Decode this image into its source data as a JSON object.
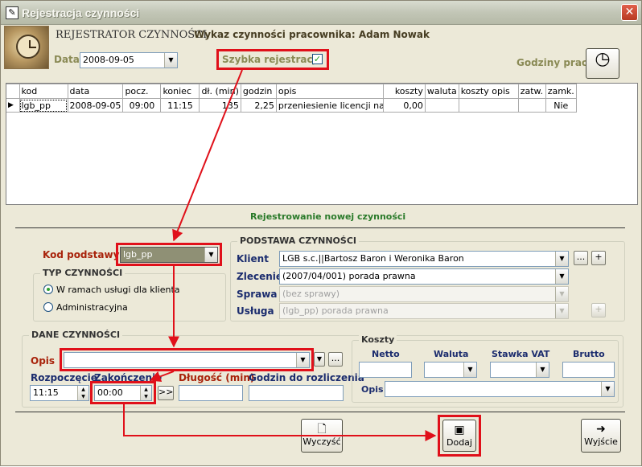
{
  "window": {
    "title": "Rejestracja czynności",
    "close_label": "✕"
  },
  "header": {
    "app_name": "REJESTRATOR CZYNNOŚCI",
    "employee_label": "Wykaz czynności pracownika: Adam Nowak",
    "date_label": "Data",
    "date_value": "2008-09-05",
    "quick_reg_label": "Szybka rejestracja",
    "quick_reg_checked": "✓",
    "work_hours_label": "Godziny pracy"
  },
  "grid": {
    "columns": [
      "kod",
      "data",
      "pocz.",
      "koniec",
      "dł. (min)",
      "godzin",
      "opis",
      "koszty",
      "waluta",
      "koszty opis",
      "zatw.",
      "zamk."
    ],
    "rows": [
      [
        "lgb_pp",
        "2008-09-05",
        "09:00",
        "11:15",
        "135",
        "2,25",
        "przeniesienie licencji na i...",
        "0,00",
        "",
        "",
        "",
        "Nie"
      ]
    ]
  },
  "new_section": {
    "title": "Rejestrowanie nowej czynności"
  },
  "kod": {
    "label": "Kod podstawy",
    "value": "lgb_pp"
  },
  "typ": {
    "title": "TYP CZYNNOŚCI",
    "options": [
      "W ramach usługi dla klienta",
      "Administracyjna"
    ]
  },
  "podstawa": {
    "title": "PODSTAWA CZYNNOŚCI",
    "klient_label": "Klient",
    "klient_value": "LGB s.c.||Bartosz Baron i Weronika Baron",
    "zlecenie_label": "Zlecenie",
    "zlecenie_value": "(2007/04/001) porada prawna",
    "sprawa_label": "Sprawa",
    "sprawa_value": "(bez sprawy)",
    "usluga_label": "Usługa",
    "usluga_value": "(lgb_pp) porada prawna",
    "more_label": "...",
    "plus_label": "+"
  },
  "dane": {
    "title": "DANE CZYNNOŚCI",
    "opis_label": "Opis",
    "opis_value": "",
    "more_label": "...",
    "start_label": "Rozpoczęcie",
    "start_value": "11:15",
    "end_label": "Zakończenie",
    "end_value": "00:00",
    "copy_label": ">>",
    "length_label": "Długość (min)",
    "length_value": "",
    "hours_label": "Godzin do rozliczenia",
    "hours_value": ""
  },
  "koszty": {
    "title": "Koszty",
    "netto_label": "Netto",
    "waluta_label": "Waluta",
    "vat_label": "Stawka VAT",
    "brutto_label": "Brutto",
    "opis_label": "Opis"
  },
  "buttons": {
    "clear": "Wyczyść",
    "add": "Dodaj",
    "exit": "Wyjście"
  },
  "colors": {
    "highlight": "#e0101a"
  }
}
